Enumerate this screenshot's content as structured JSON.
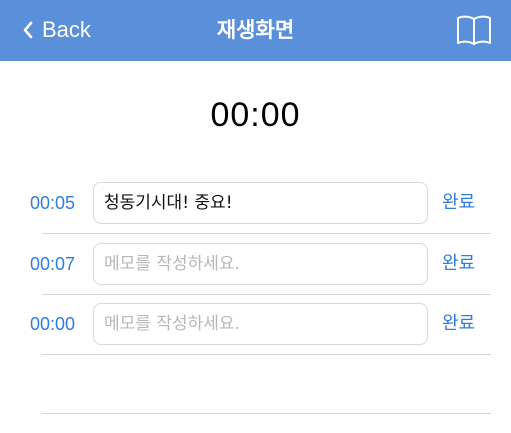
{
  "nav": {
    "back_label": "Back",
    "title": "재생화면",
    "bar_color": "#5a8fd9",
    "icons": {
      "back": "chevron-left-icon",
      "book": "book-icon"
    }
  },
  "timer": {
    "value": "00:00"
  },
  "memos": [
    {
      "time": "00:05",
      "text": "청동기시대! 중요!",
      "placeholder": "메모를 작성하세요.",
      "done_label": "완료"
    },
    {
      "time": "00:07",
      "text": "",
      "placeholder": "메모를 작성하세요.",
      "done_label": "완료"
    },
    {
      "time": "00:00",
      "text": "",
      "placeholder": "메모를 작성하세요.",
      "done_label": "완료"
    }
  ],
  "accent_color": "#2f7de1"
}
